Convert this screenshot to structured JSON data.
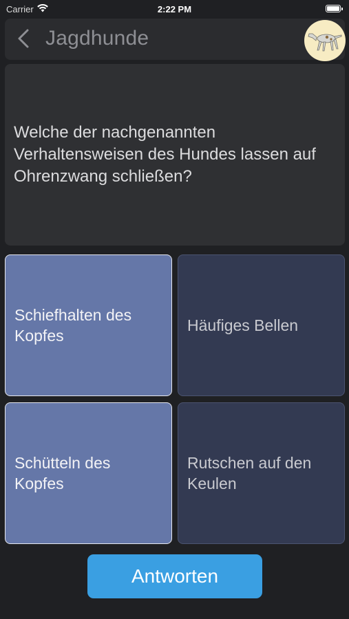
{
  "status_bar": {
    "carrier": "Carrier",
    "time": "2:22 PM",
    "wifi_icon": "wifi-icon",
    "battery_icon": "battery-icon"
  },
  "nav": {
    "back_icon": "chevron-left-icon",
    "title": "Jagdhunde",
    "avatar_icon": "hunting-dog-icon"
  },
  "question": {
    "text": "Welche der nachgenannten Verhaltensweisen des Hundes lassen auf Ohrenzwang schließen?"
  },
  "answers": [
    {
      "label": "Schiefhalten des Kopfes",
      "selected": true
    },
    {
      "label": "Häufiges Bellen",
      "selected": false
    },
    {
      "label": "Schütteln des Kopfes",
      "selected": true
    },
    {
      "label": "Rutschen auf den Keulen",
      "selected": false
    }
  ],
  "submit": {
    "label": "Antworten"
  },
  "colors": {
    "background": "#1f2023",
    "card": "#2f3033",
    "answer_selected": "#6577a8",
    "answer_unselected": "#333a52",
    "submit_button": "#3a9fe2"
  }
}
